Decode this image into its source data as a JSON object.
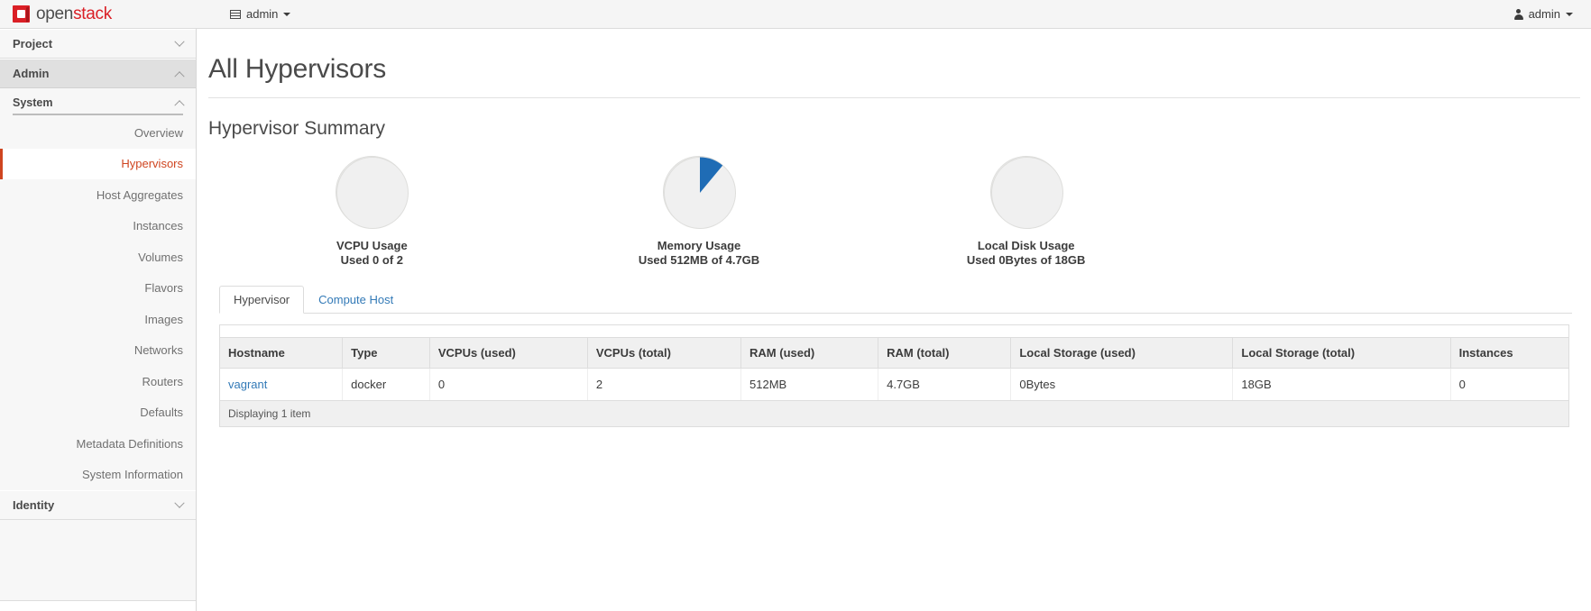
{
  "topbar": {
    "brand_open": "open",
    "brand_stack": "stack",
    "project_selector": "admin",
    "project_icon": "grid-icon",
    "user_menu": "admin",
    "user_icon": "user-icon"
  },
  "sidebar": {
    "groups": [
      {
        "label": "Project",
        "state": "collapsed",
        "icon": "chevron-down-icon"
      },
      {
        "label": "Admin",
        "state": "expanded",
        "icon": "chevron-up-icon"
      }
    ],
    "subheader": {
      "label": "System",
      "state": "expanded",
      "icon": "chevron-up-icon"
    },
    "items": [
      {
        "label": "Overview",
        "active": false
      },
      {
        "label": "Hypervisors",
        "active": true
      },
      {
        "label": "Host Aggregates",
        "active": false
      },
      {
        "label": "Instances",
        "active": false
      },
      {
        "label": "Volumes",
        "active": false
      },
      {
        "label": "Flavors",
        "active": false
      },
      {
        "label": "Images",
        "active": false
      },
      {
        "label": "Networks",
        "active": false
      },
      {
        "label": "Routers",
        "active": false
      },
      {
        "label": "Defaults",
        "active": false
      },
      {
        "label": "Metadata Definitions",
        "active": false
      },
      {
        "label": "System Information",
        "active": false
      }
    ],
    "footer_group": {
      "label": "Identity",
      "state": "collapsed",
      "icon": "chevron-down-icon"
    }
  },
  "main": {
    "page_title": "All Hypervisors",
    "section_title": "Hypervisor Summary"
  },
  "chart_data": [
    {
      "type": "pie",
      "title": "VCPU Usage",
      "subtitle": "Used 0 of 2",
      "used": 0,
      "total": 2,
      "unit": "vcpu",
      "percent_used": 0,
      "categories": [
        "Used",
        "Free"
      ],
      "values": [
        0,
        2
      ],
      "colors": [
        "#1f6cb5",
        "#f0f0f0"
      ],
      "legend": "none"
    },
    {
      "type": "pie",
      "title": "Memory Usage",
      "subtitle": "Used 512MB of 4.7GB",
      "used": 512,
      "total": 4812.8,
      "unit": "MB",
      "percent_used": 10.6,
      "categories": [
        "Used",
        "Free"
      ],
      "values": [
        10.6,
        89.4
      ],
      "colors": [
        "#1f6cb5",
        "#f0f0f0"
      ],
      "legend": "none"
    },
    {
      "type": "pie",
      "title": "Local Disk Usage",
      "subtitle": "Used 0Bytes of 18GB",
      "used": 0,
      "total": 18,
      "unit": "GB",
      "percent_used": 0,
      "categories": [
        "Used",
        "Free"
      ],
      "values": [
        0,
        18
      ],
      "colors": [
        "#1f6cb5",
        "#f0f0f0"
      ],
      "legend": "none"
    }
  ],
  "tabs": [
    {
      "label": "Hypervisor",
      "active": true
    },
    {
      "label": "Compute Host",
      "active": false
    }
  ],
  "table": {
    "columns": [
      "Hostname",
      "Type",
      "VCPUs (used)",
      "VCPUs (total)",
      "RAM (used)",
      "RAM (total)",
      "Local Storage (used)",
      "Local Storage (total)",
      "Instances"
    ],
    "rows": [
      {
        "hostname": "vagrant",
        "type": "docker",
        "vcpus_used": "0",
        "vcpus_total": "2",
        "ram_used": "512MB",
        "ram_total": "4.7GB",
        "storage_used": "0Bytes",
        "storage_total": "18GB",
        "instances": "0"
      }
    ],
    "footer": "Displaying 1 item"
  },
  "colors": {
    "brand_red": "#da1f26",
    "active_nav": "#cf4520",
    "link_blue": "#337ab7",
    "chart_blue": "#1f6cb5",
    "chart_grey": "#f0f0f0"
  }
}
